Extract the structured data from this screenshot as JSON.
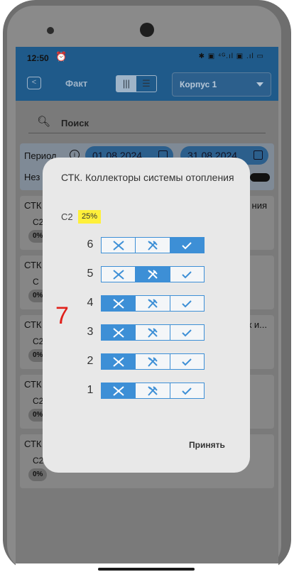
{
  "status_bar": {
    "time": "12:50",
    "icons": "✱ ▣ ⁴ᴳ.ıl ▣ .ıl ▭"
  },
  "app_bar": {
    "title": "Факт",
    "building_select": {
      "value": "Корпус 1"
    }
  },
  "search": {
    "placeholder": "Поиск"
  },
  "filters": {
    "period_label": "Период",
    "date_from": "01.08.2024",
    "date_to": "31.08.2024",
    "second_label": "Нез"
  },
  "cards": [
    {
      "title": "СТК",
      "trail": "ния",
      "sub": "С2",
      "pct": "0%"
    },
    {
      "title": "СТК",
      "trail": "",
      "sub": "С",
      "pct": "0%"
    },
    {
      "title": "СТК",
      "trail": "к и...",
      "sub": "С2",
      "pct": "0%"
    },
    {
      "title": "СТК",
      "trail": "",
      "sub": "С2",
      "pct": "0%"
    },
    {
      "title": "СТК",
      "trail": "",
      "sub": "С2",
      "pct": "0%"
    }
  ],
  "dialog": {
    "title": "СТК. Коллекторы системы отопления",
    "sub_code": "С2",
    "sub_percent": "25%",
    "accept_label": "Принять",
    "floors": [
      {
        "num": "6",
        "state": "done"
      },
      {
        "num": "5",
        "state": "in_progress"
      },
      {
        "num": "4",
        "state": "not_done"
      },
      {
        "num": "3",
        "state": "not_done"
      },
      {
        "num": "2",
        "state": "not_done"
      },
      {
        "num": "1",
        "state": "not_done"
      }
    ]
  },
  "marker_text": "7",
  "colors": {
    "accent": "#3d8fd6",
    "highlight": "#fff03a",
    "marker": "#e0201a",
    "app_bar": "#1f5a8a"
  }
}
